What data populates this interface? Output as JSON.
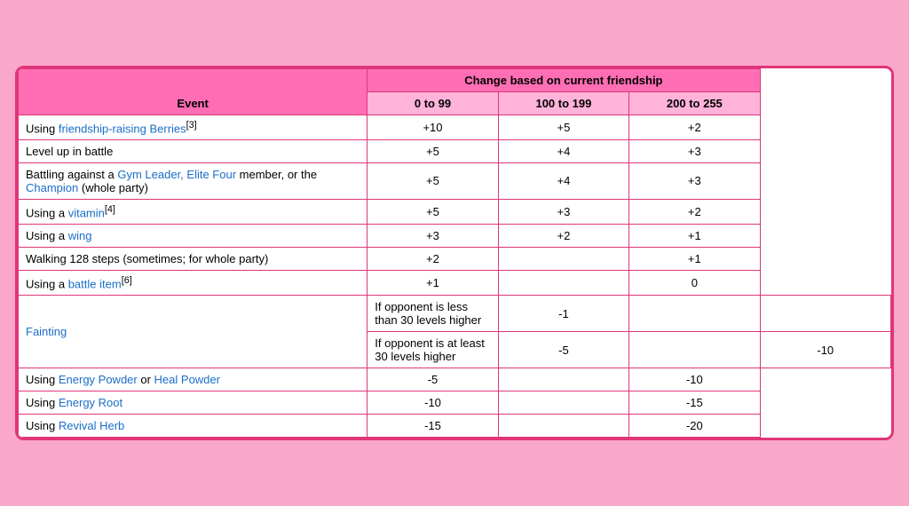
{
  "table": {
    "header": {
      "event_label": "Event",
      "change_label": "Change based on current friendship",
      "range1": "0 to 99",
      "range2": "100 to 199",
      "range3": "200 to 255"
    },
    "rows": [
      {
        "event_parts": [
          {
            "text": "Using ",
            "link": false
          },
          {
            "text": "friendship-raising Berries",
            "link": true
          },
          {
            "text": "[3]",
            "link": false,
            "sup": true
          }
        ],
        "val1": "+10",
        "val2": "+5",
        "val3": "+2"
      },
      {
        "event_parts": [
          {
            "text": "Level",
            "link": false
          },
          {
            "text": " up",
            "link": false
          },
          {
            "text": " in battle",
            "link": false
          }
        ],
        "event_html": "Level up in battle",
        "val1": "+5",
        "val2": "+4",
        "val3": "+3"
      },
      {
        "event_html": "Battling against a <a class='link'>Gym Leader, Elite Four</a> member, or the <a class='link'>Champion</a> (whole party)",
        "val1": "+5",
        "val2": "+4",
        "val3": "+3"
      },
      {
        "event_html": "Using a <a class='link'>vitamin</a><sup>[4]</sup>",
        "val1": "+5",
        "val2": "+3",
        "val3": "+2"
      },
      {
        "event_html": "Using a <a class='link'>wing</a>",
        "val1": "+3",
        "val2": "+2",
        "val3": "+1"
      },
      {
        "event_html": "Walking 128 steps (sometimes; for whole party)",
        "val1": "+2",
        "val2": "",
        "val3": "+1"
      },
      {
        "event_html": "Using a <a class='link'>battle item</a><sup>[6]</sup>",
        "val1": "+1",
        "val2": "",
        "val3": "0"
      },
      {
        "fainting": true,
        "sub1_text": "If opponent is less than 30 levels higher",
        "sub1_val1": "-1",
        "sub1_val2": "",
        "sub1_val3": "",
        "sub2_text": "If opponent is at least 30 levels higher",
        "sub2_val1": "-5",
        "sub2_val2": "",
        "sub2_val3": "-10"
      },
      {
        "event_html": "Using <a class='link'>Energy Powder</a> or <a class='link'>Heal Powder</a>",
        "val1": "-5",
        "val2": "",
        "val3": "-10"
      },
      {
        "event_html": "Using <a class='link'>Energy Root</a>",
        "val1": "-10",
        "val2": "",
        "val3": "-15"
      },
      {
        "event_html": "Using <a class='link'>Revival Herb</a>",
        "val1": "-15",
        "val2": "",
        "val3": "-20"
      }
    ]
  }
}
